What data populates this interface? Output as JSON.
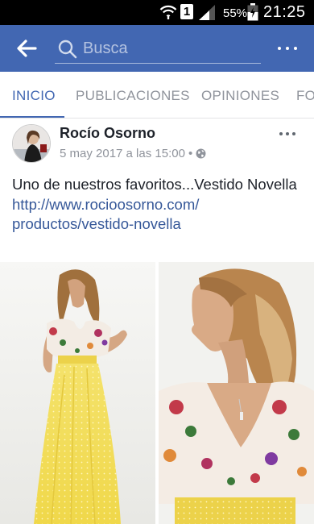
{
  "status_bar": {
    "sim_slot": "1",
    "battery_percent": "55%",
    "time": "21:25",
    "icons": [
      "wifi-icon",
      "signal-icon",
      "battery-icon"
    ]
  },
  "app_bar": {
    "search_placeholder": "Busca",
    "color": "#4267b2"
  },
  "tabs": [
    {
      "label": "INICIO",
      "active": true
    },
    {
      "label": "PUBLICACIONES",
      "active": false
    },
    {
      "label": "OPINIONES",
      "active": false
    },
    {
      "label": "FO",
      "active": false
    }
  ],
  "post": {
    "page_name": "Rocío Osorno",
    "date": "5 may 2017 a las 15:00",
    "separator": "•",
    "privacy_icon": "globe-icon",
    "text": "Uno de nuestros favoritos...Vestido Novella",
    "link_line1": "http://www.rocioosorno.com/",
    "link_line2": "productos/vestido-novella",
    "link_color": "#365899"
  }
}
